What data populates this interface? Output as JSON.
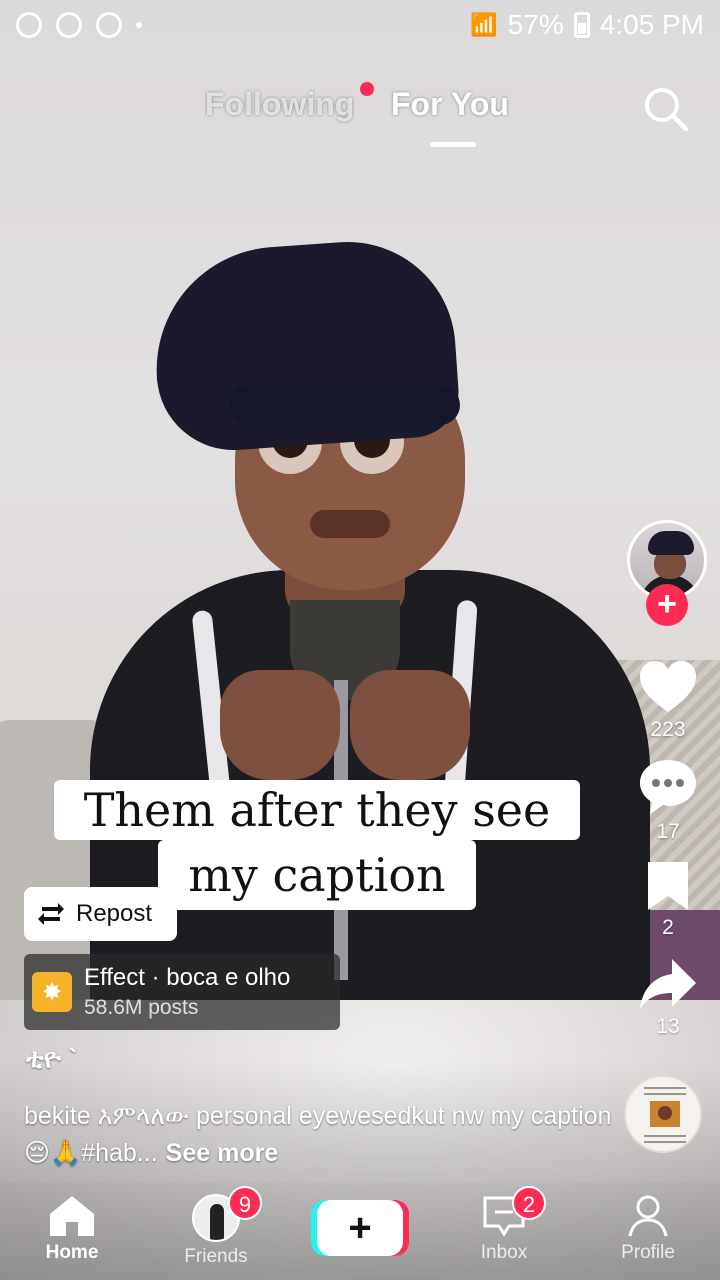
{
  "status_bar": {
    "battery": "57%",
    "time": "4:05 PM"
  },
  "top_tabs": {
    "following": "Following",
    "for_you": "For You"
  },
  "video": {
    "caption_line1": "Them after they see",
    "caption_line2": "my caption"
  },
  "actions": {
    "likes": "223",
    "comments": "17",
    "saves": "2",
    "shares": "13"
  },
  "repost_label": "Repost",
  "effect": {
    "title": "Effect · boca e olho",
    "posts": "58.6M posts"
  },
  "username": "ቲዮ `",
  "description": {
    "text": "bekite እምላለው personal eyewesedkut nw my caption 😔🙏#hab...",
    "see_more": "See more"
  },
  "nav": {
    "home": "Home",
    "friends": "Friends",
    "friends_badge": "9",
    "inbox": "Inbox",
    "inbox_badge": "2",
    "profile": "Profile"
  },
  "colors": {
    "accent": "#fe2c55",
    "cyan": "#25f4ee"
  }
}
